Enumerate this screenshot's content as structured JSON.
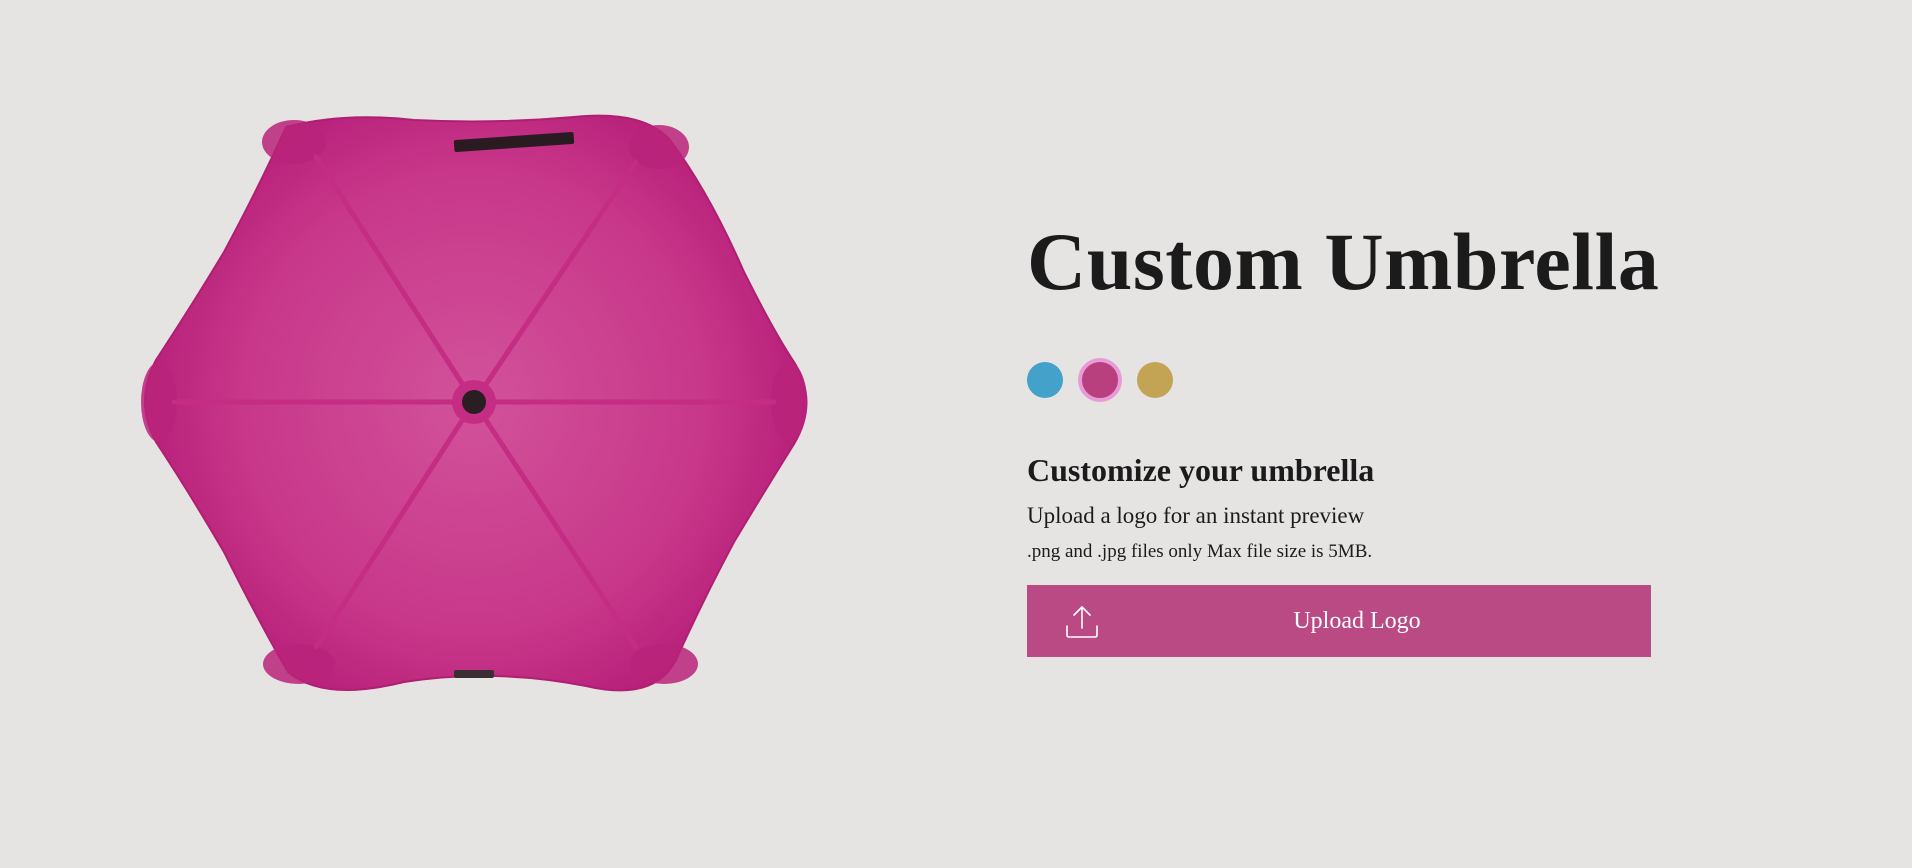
{
  "product": {
    "title": "Custom Umbrella",
    "image_alt": "pink umbrella top view"
  },
  "colors": {
    "background": "#e6e4e3",
    "canopy": "#c9307f",
    "button": "#b94a84",
    "selected_ring": "#e89bd6"
  },
  "swatches": [
    {
      "name": "blue",
      "color": "#44a1c9",
      "selected": false
    },
    {
      "name": "pink",
      "color": "#b8407f",
      "selected": true
    },
    {
      "name": "gold",
      "color": "#c3a454",
      "selected": false
    }
  ],
  "customize": {
    "heading": "Customize your umbrella",
    "description": "Upload a logo for an instant preview",
    "note": ".png and .jpg files only Max file size is 5MB."
  },
  "upload": {
    "label": "Upload Logo",
    "icon": "upload-icon"
  }
}
